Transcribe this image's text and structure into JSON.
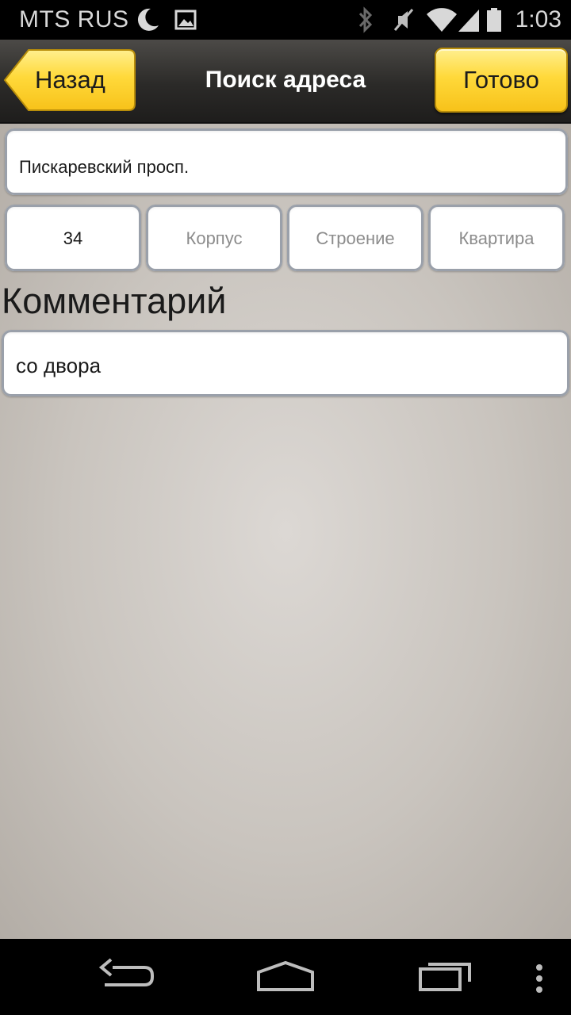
{
  "status_bar": {
    "carrier": "MTS RUS",
    "time": "1:03",
    "icons": [
      "moon-icon",
      "image-icon",
      "bluetooth-icon",
      "mute-icon",
      "wifi-icon",
      "signal-icon",
      "battery-icon"
    ]
  },
  "header": {
    "back_label": "Назад",
    "title": "Поиск адреса",
    "done_label": "Готово"
  },
  "form": {
    "street_value": "Пискаревский просп.",
    "house_value": "34",
    "building_placeholder": "Корпус",
    "structure_placeholder": "Строение",
    "apartment_placeholder": "Квартира",
    "comment_label": "Комментарий",
    "comment_value": "со двора"
  },
  "nav_bar": {
    "icons": [
      "back-nav-icon",
      "home-nav-icon",
      "recents-nav-icon",
      "menu-nav-icon"
    ]
  },
  "colors": {
    "accent_yellow": "#ffd93a",
    "header_dark": "#2b2a28",
    "field_border": "#9aa0aa"
  }
}
